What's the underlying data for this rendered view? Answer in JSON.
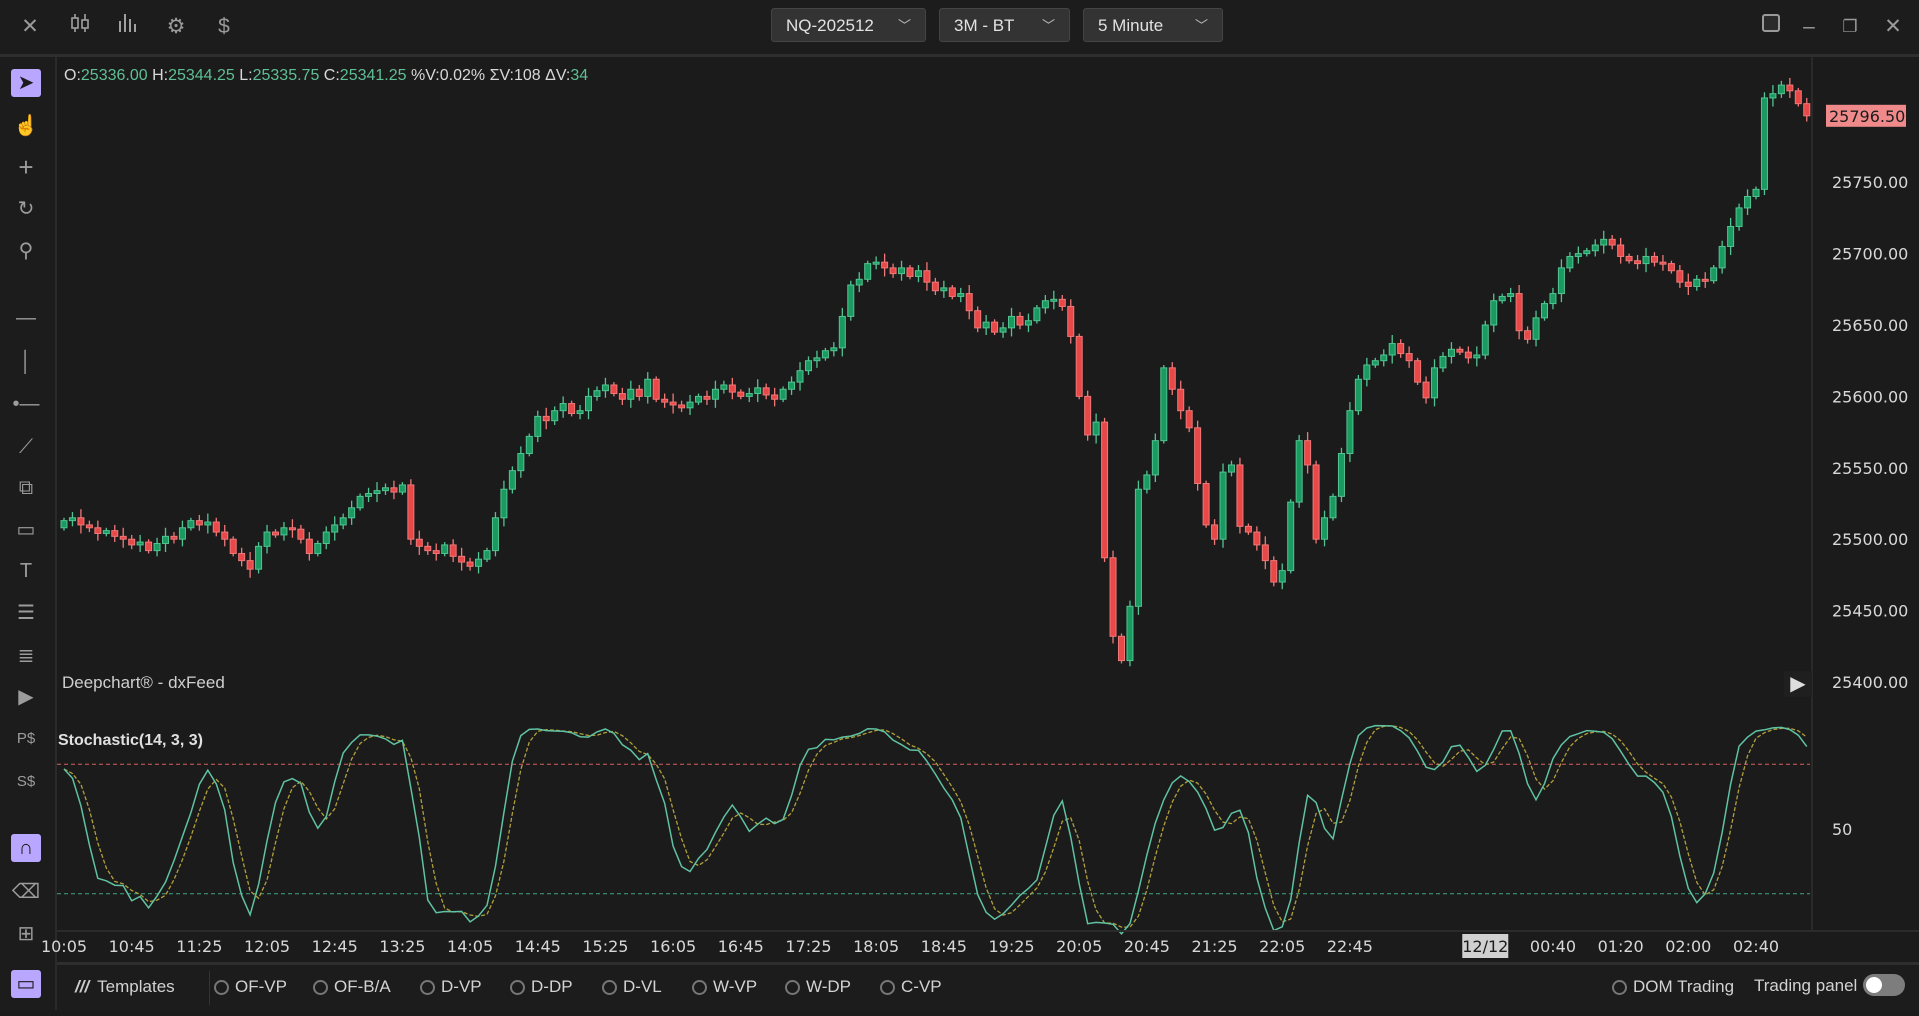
{
  "topbar": {
    "icons": [
      "close-icon",
      "candlestick-chart-icon",
      "bar-chart-icon",
      "gear-icon",
      "dollar-icon"
    ],
    "symbol": "NQ-202512",
    "range": "3M - BT",
    "interval": "5 Minute",
    "window_controls": [
      "screenshot-icon",
      "minimize-icon",
      "restore-icon",
      "close-icon"
    ]
  },
  "toolbar": {
    "tools": [
      {
        "name": "pointer",
        "active": true
      },
      {
        "name": "hand"
      },
      {
        "name": "crosshair"
      },
      {
        "name": "magnet-cursor"
      },
      {
        "name": "zoom"
      },
      {
        "name": "horizontal-line"
      },
      {
        "name": "vertical-line"
      },
      {
        "name": "ray"
      },
      {
        "name": "trend-line"
      },
      {
        "name": "parallel-channel"
      },
      {
        "name": "rectangle"
      },
      {
        "name": "text"
      },
      {
        "name": "fibonacci"
      },
      {
        "name": "fib-levels"
      },
      {
        "name": "volume-profile"
      },
      {
        "name": "price-order"
      },
      {
        "name": "stop-order"
      },
      {
        "name": "magnet",
        "active": true
      },
      {
        "name": "eraser"
      },
      {
        "name": "add-pane"
      },
      {
        "name": "layout",
        "active": true
      }
    ]
  },
  "info": {
    "o_label": "O:",
    "o": "25336.00",
    "h_label": "H:",
    "h": "25344.25",
    "l_label": "L:",
    "l": "25335.75",
    "c_label": "C:",
    "c": "25341.25",
    "pv_label": "%V:",
    "pv": "0.02%",
    "sv_label": "ΣV:",
    "sv": "108",
    "dv_label": "ΔV:",
    "dv": "34"
  },
  "brand": "Deepchart® - dxFeed",
  "colors": {
    "up": "#1a9a60",
    "up_border": "#52c491",
    "down": "#e84848",
    "down_border": "#f07878",
    "last_price_bg": "#f08a8a",
    "k_line": "#5fc2a2",
    "d_line": "#b0a03c",
    "upper_level": "#d46060",
    "lower_level": "#3fa482"
  },
  "chart_data": [
    {
      "type": "candlestick",
      "interval": "5 Minute",
      "last_price": "25796.50",
      "y_ticks": [
        "25400.00",
        "25450.00",
        "25500.00",
        "25550.00",
        "25600.00",
        "25650.00",
        "25700.00",
        "25750.00"
      ],
      "ylim": [
        25385,
        25830
      ],
      "x_ticks": [
        {
          "bar": 0,
          "label": "10:05"
        },
        {
          "bar": 8,
          "label": "10:45"
        },
        {
          "bar": 16,
          "label": "11:25"
        },
        {
          "bar": 24,
          "label": "12:05"
        },
        {
          "bar": 32,
          "label": "12:45"
        },
        {
          "bar": 40,
          "label": "13:25"
        },
        {
          "bar": 48,
          "label": "14:05"
        },
        {
          "bar": 56,
          "label": "14:45"
        },
        {
          "bar": 64,
          "label": "15:25"
        },
        {
          "bar": 72,
          "label": "16:05"
        },
        {
          "bar": 80,
          "label": "16:45"
        },
        {
          "bar": 88,
          "label": "17:25"
        },
        {
          "bar": 96,
          "label": "18:05"
        },
        {
          "bar": 104,
          "label": "18:45"
        },
        {
          "bar": 112,
          "label": "19:25"
        },
        {
          "bar": 120,
          "label": "20:05"
        },
        {
          "bar": 128,
          "label": "20:45"
        },
        {
          "bar": 136,
          "label": "21:25"
        },
        {
          "bar": 144,
          "label": "22:05"
        },
        {
          "bar": 152,
          "label": "22:45"
        },
        {
          "bar": 168,
          "label": "12/12",
          "highlight": true
        },
        {
          "bar": 176,
          "label": "00:40"
        },
        {
          "bar": 184,
          "label": "01:20"
        },
        {
          "bar": 192,
          "label": "02:00"
        },
        {
          "bar": 200,
          "label": "02:40"
        }
      ],
      "close": [
        25513,
        25515,
        25510,
        25508,
        25504,
        25506,
        25502,
        25500,
        25496,
        25498,
        25492,
        25497,
        25502,
        25500,
        25508,
        25513,
        25510,
        25512,
        25505,
        25500,
        25490,
        25485,
        25479,
        25495,
        25505,
        25503,
        25508,
        25507,
        25500,
        25490,
        25497,
        25505,
        25510,
        25515,
        25522,
        25530,
        25532,
        25534,
        25536,
        25533,
        25538,
        25500,
        25495,
        25492,
        25490,
        25496,
        25488,
        25484,
        25481,
        25486,
        25492,
        25515,
        25535,
        25548,
        25560,
        25572,
        25586,
        25583,
        25590,
        25595,
        25588,
        25590,
        25600,
        25604,
        25608,
        25602,
        25598,
        25605,
        25600,
        25612,
        25598,
        25596,
        25594,
        25592,
        25596,
        25600,
        25598,
        25605,
        25608,
        25603,
        25600,
        25602,
        25606,
        25601,
        25598,
        25605,
        25610,
        25618,
        25625,
        25627,
        25632,
        25634,
        25656,
        25678,
        25682,
        25693,
        25694,
        25690,
        25686,
        25690,
        25684,
        25688,
        25680,
        25674,
        25676,
        25670,
        25672,
        25660,
        25648,
        25652,
        25645,
        25648,
        25656,
        25650,
        25653,
        25662,
        25667,
        25668,
        25663,
        25642,
        25600,
        25573,
        25582,
        25487,
        25432,
        25415,
        25453,
        25535,
        25545,
        25569,
        25620,
        25605,
        25590,
        25578,
        25539,
        25510,
        25500,
        25547,
        25552,
        25509,
        25505,
        25496,
        25485,
        25470,
        25478,
        25526,
        25569,
        25552,
        25500,
        25515,
        25530,
        25560,
        25590,
        25612,
        25622,
        25625,
        25629,
        25637,
        25630,
        25625,
        25610,
        25599,
        25620,
        25628,
        25633,
        25631,
        25627,
        25629,
        25650,
        25667,
        25670,
        25672,
        25646,
        25640,
        25655,
        25665,
        25672,
        25690,
        25698,
        25700,
        25702,
        25706,
        25710,
        25706,
        25698,
        25695,
        25693,
        25698,
        25694,
        25693,
        25688,
        25680,
        25677,
        25682,
        25681,
        25690,
        25705,
        25719,
        25732,
        25740,
        25745,
        25809,
        25812,
        25818,
        25814,
        25805,
        25796.5
      ]
    },
    {
      "type": "line",
      "title": "Stochastic(14, 3, 3)",
      "k_period": 14,
      "k_smooth": 3,
      "d_period": 3,
      "levels": [
        80,
        20
      ],
      "y_ticks": [
        "50"
      ],
      "ylim": [
        0,
        100
      ]
    }
  ],
  "bottombar": {
    "templates_label": "Templates",
    "templates": [
      "OF-VP",
      "OF-B/A",
      "D-VP",
      "D-DP",
      "D-VL",
      "W-VP",
      "W-DP",
      "C-VP"
    ],
    "dom_trading": "DOM Trading",
    "trading_panel": "Trading panel",
    "trading_panel_on": false
  }
}
